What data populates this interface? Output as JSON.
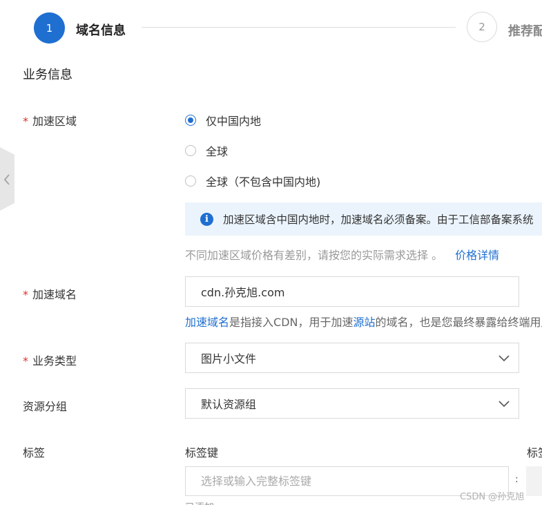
{
  "stepper": {
    "step1": {
      "number": "1",
      "label": "域名信息"
    },
    "step2": {
      "number": "2",
      "label": "推荐配"
    }
  },
  "section_title": "业务信息",
  "accel_region": {
    "label": "加速区域",
    "required_mark": "*",
    "options": [
      {
        "label": "仅中国内地",
        "checked": true
      },
      {
        "label": "全球",
        "checked": false
      },
      {
        "label": "全球（不包含中国内地)",
        "checked": false
      }
    ],
    "banner": "加速区域含中国内地时，加速域名必须备案。由于工信部备案系统",
    "hint": "不同加速区域价格有差别，请按您的实际需求选择 。",
    "price_link": "价格详情"
  },
  "accel_domain": {
    "label": "加速域名",
    "required_mark": "*",
    "value": "cdn.孙克旭.com",
    "desc_link1": "加速域名",
    "desc_text1": "是指接入CDN，用于加速",
    "desc_link2": "源站",
    "desc_text2": "的域名，也是您最终暴露给终端用户"
  },
  "business_type": {
    "label": "业务类型",
    "required_mark": "*",
    "value": "图片小文件"
  },
  "resource_group": {
    "label": "资源分组",
    "value": "默认资源组"
  },
  "tags": {
    "label": "标签",
    "key_label": "标签键",
    "value_label": "标签值",
    "key_placeholder": "选择或输入完整标签键",
    "colon": ":",
    "below_text": "已添加"
  },
  "watermark": "CSDN @孙克旭",
  "colors": {
    "accent": "#1f6fd1",
    "required": "#e0322d",
    "banner_bg": "#ebf4fc"
  }
}
